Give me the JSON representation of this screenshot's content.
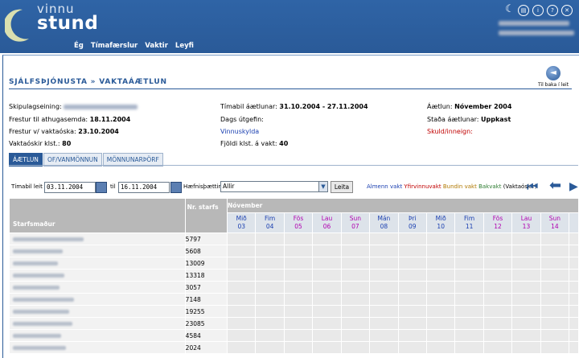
{
  "header": {
    "logo_top": "vinnu",
    "logo_bottom": "stund",
    "nav": [
      "Ég",
      "Tímafærslur",
      "Vaktir",
      "Leyfi"
    ],
    "top_icons": [
      "moon-icon",
      "print-icon",
      "info-icon",
      "help-icon",
      "close-icon"
    ]
  },
  "page": {
    "title": "SJÁLFSÞJÓNUSTA » VAKTAÁÆTLUN",
    "back_label": "Til baka í leit"
  },
  "info": {
    "skipulag_label": "Skipulagseining:",
    "frestur_athugasemd_label": "Frestur til athugasemda:",
    "frestur_athugasemd_value": "18.11.2004",
    "frestur_vakt_label": "Frestur v/ vaktaóska:",
    "frestur_vakt_value": "23.10.2004",
    "vaktaoskir_label": "Vaktaóskir klst.:",
    "vaktaoskir_value": "80",
    "timabil_label": "Tímabil áætlunar:",
    "timabil_value": "31.10.2004 - 27.11.2004",
    "dags_label": "Dags útgefin:",
    "vinnuskylda_link": "Vinnuskylda",
    "fjoldi_label": "Fjöldi klst. á vakt:",
    "fjoldi_value": "40",
    "aaetlun_label": "Áætlun:",
    "aaetlun_value": "Nóvember 2004",
    "stada_label": "Staða áætlunar:",
    "stada_value": "Uppkast",
    "skuld_link": "Skuld/inneign:"
  },
  "tabs": [
    "ÁÆTLUN",
    "OF/VANMÖNNUN",
    "MÖNNUNARÞÖRF"
  ],
  "filter": {
    "timabil_label": "Tímabil leit",
    "date_from": "03.11.2004",
    "til_label": "til",
    "date_to": "16.11.2004",
    "haefni_label": "Hæfnisþættir:",
    "haefni_value": "Allir",
    "leita_label": "Leita"
  },
  "legend": {
    "almenn": "Almenn vakt",
    "yfirvinnu": "Yfirvinnuvakt",
    "bundin": "Bundin vakt",
    "bakvakt": "Bakvakt",
    "vaktaoskir": "(Vaktaóskir)",
    "colors": {
      "almenn": "#1a3fb0",
      "yfirvinnu": "#c00000",
      "bundin": "#b07800",
      "bakvakt": "#2e7d32"
    }
  },
  "table": {
    "col_staff": "Starfsmaður",
    "col_nr": "Nr. starfs",
    "month": "Nóvember",
    "days": [
      {
        "d": "Mið",
        "n": "03",
        "c": "#1a3fb0"
      },
      {
        "d": "Fim",
        "n": "04",
        "c": "#1a3fb0"
      },
      {
        "d": "Fös",
        "n": "05",
        "c": "#b000b0"
      },
      {
        "d": "Lau",
        "n": "06",
        "c": "#b000b0"
      },
      {
        "d": "Sun",
        "n": "07",
        "c": "#b000b0"
      },
      {
        "d": "Mán",
        "n": "08",
        "c": "#1a3fb0"
      },
      {
        "d": "Þri",
        "n": "09",
        "c": "#1a3fb0"
      },
      {
        "d": "Mið",
        "n": "10",
        "c": "#1a3fb0"
      },
      {
        "d": "Fim",
        "n": "11",
        "c": "#1a3fb0"
      },
      {
        "d": "Fös",
        "n": "12",
        "c": "#b000b0"
      },
      {
        "d": "Lau",
        "n": "13",
        "c": "#b000b0"
      },
      {
        "d": "Sun",
        "n": "14",
        "c": "#b000b0"
      }
    ],
    "rows": [
      "5797",
      "5608",
      "13009",
      "13318",
      "3057",
      "7148",
      "19255",
      "23085",
      "4584",
      "2024"
    ]
  }
}
